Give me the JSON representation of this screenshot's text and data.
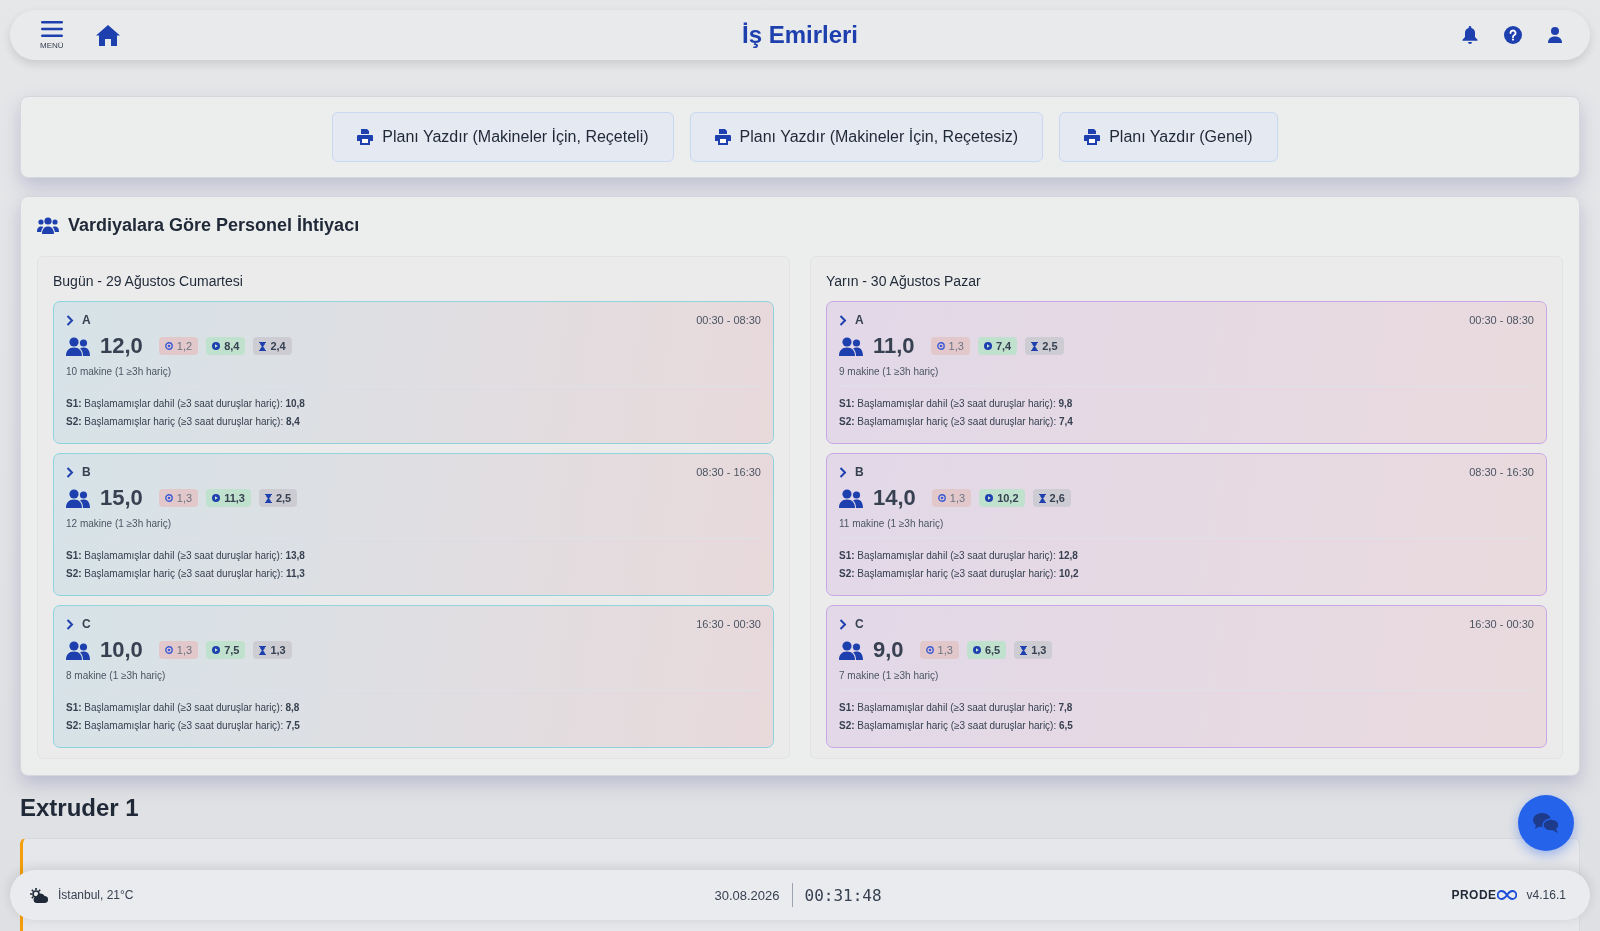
{
  "header": {
    "menu_label": "MENÜ",
    "title": "İş Emirleri"
  },
  "print_buttons": [
    "Planı Yazdır (Makineler İçin, Reçeteli)",
    "Planı Yazdır (Makineler İçin, Reçetesiz)",
    "Planı Yazdır (Genel)"
  ],
  "personnel": {
    "title": "Vardiyalara Göre Personel İhtiyacı",
    "days": [
      {
        "kind": "today",
        "title": "Bugün - 29 Ağustos Cumartesi",
        "shifts": [
          {
            "name": "A",
            "time": "00:30 - 08:30",
            "total": "12,0",
            "badges": [
              {
                "kind": "stopped",
                "value": "1,2"
              },
              {
                "kind": "running",
                "value": "8,4"
              },
              {
                "kind": "waiting",
                "value": "2,4"
              }
            ],
            "machines": "10 makine (1 ≥3h hariç)",
            "s1": "**S1:** Başlamamışlar dahil (≥3 saat duruşlar hariç): **10,8**",
            "s2": "**S2:** Başlamamışlar hariç (≥3 saat duruşlar hariç): **8,4**"
          },
          {
            "name": "B",
            "time": "08:30 - 16:30",
            "total": "15,0",
            "badges": [
              {
                "kind": "stopped",
                "value": "1,3"
              },
              {
                "kind": "running",
                "value": "11,3"
              },
              {
                "kind": "waiting",
                "value": "2,5"
              }
            ],
            "machines": "12 makine (1 ≥3h hariç)",
            "s1": "**S1:** Başlamamışlar dahil (≥3 saat duruşlar hariç): **13,8**",
            "s2": "**S2:** Başlamamışlar hariç (≥3 saat duruşlar hariç): **11,3**"
          },
          {
            "name": "C",
            "time": "16:30 - 00:30",
            "total": "10,0",
            "badges": [
              {
                "kind": "stopped",
                "value": "1,3"
              },
              {
                "kind": "running",
                "value": "7,5"
              },
              {
                "kind": "waiting",
                "value": "1,3"
              }
            ],
            "machines": "8 makine (1 ≥3h hariç)",
            "s1": "**S1:** Başlamamışlar dahil (≥3 saat duruşlar hariç): **8,8**",
            "s2": "**S2:** Başlamamışlar hariç (≥3 saat duruşlar hariç): **7,5**"
          }
        ]
      },
      {
        "kind": "tomorrow",
        "title": "Yarın - 30 Ağustos Pazar",
        "shifts": [
          {
            "name": "A",
            "time": "00:30 - 08:30",
            "total": "11,0",
            "badges": [
              {
                "kind": "stopped",
                "value": "1,3"
              },
              {
                "kind": "running",
                "value": "7,4"
              },
              {
                "kind": "waiting",
                "value": "2,5"
              }
            ],
            "machines": "9 makine (1 ≥3h hariç)",
            "s1": "**S1:** Başlamamışlar dahil (≥3 saat duruşlar hariç): **9,8**",
            "s2": "**S2:** Başlamamışlar hariç (≥3 saat duruşlar hariç): **7,4**"
          },
          {
            "name": "B",
            "time": "08:30 - 16:30",
            "total": "14,0",
            "badges": [
              {
                "kind": "stopped",
                "value": "1,3"
              },
              {
                "kind": "running",
                "value": "10,2"
              },
              {
                "kind": "waiting",
                "value": "2,6"
              }
            ],
            "machines": "11 makine (1 ≥3h hariç)",
            "s1": "**S1:** Başlamamışlar dahil (≥3 saat duruşlar hariç): **12,8**",
            "s2": "**S2:** Başlamamışlar hariç (≥3 saat duruşlar hariç): **10,2**"
          },
          {
            "name": "C",
            "time": "16:30 - 00:30",
            "total": "9,0",
            "badges": [
              {
                "kind": "stopped",
                "value": "1,3"
              },
              {
                "kind": "running",
                "value": "6,5"
              },
              {
                "kind": "waiting",
                "value": "1,3"
              }
            ],
            "machines": "7 makine (1 ≥3h hariç)",
            "s1": "**S1:** Başlamamışlar dahil (≥3 saat duruşlar hariç): **7,8**",
            "s2": "**S2:** Başlamamışlar hariç (≥3 saat duruşlar hariç): **6,5**"
          }
        ]
      }
    ]
  },
  "section_title": "Extruder 1",
  "footer": {
    "weather": "İstanbul, 21°C",
    "date": "30.08.2026",
    "clock": "00:31:48",
    "logo": "PRODE",
    "version": "v4.16.1"
  }
}
